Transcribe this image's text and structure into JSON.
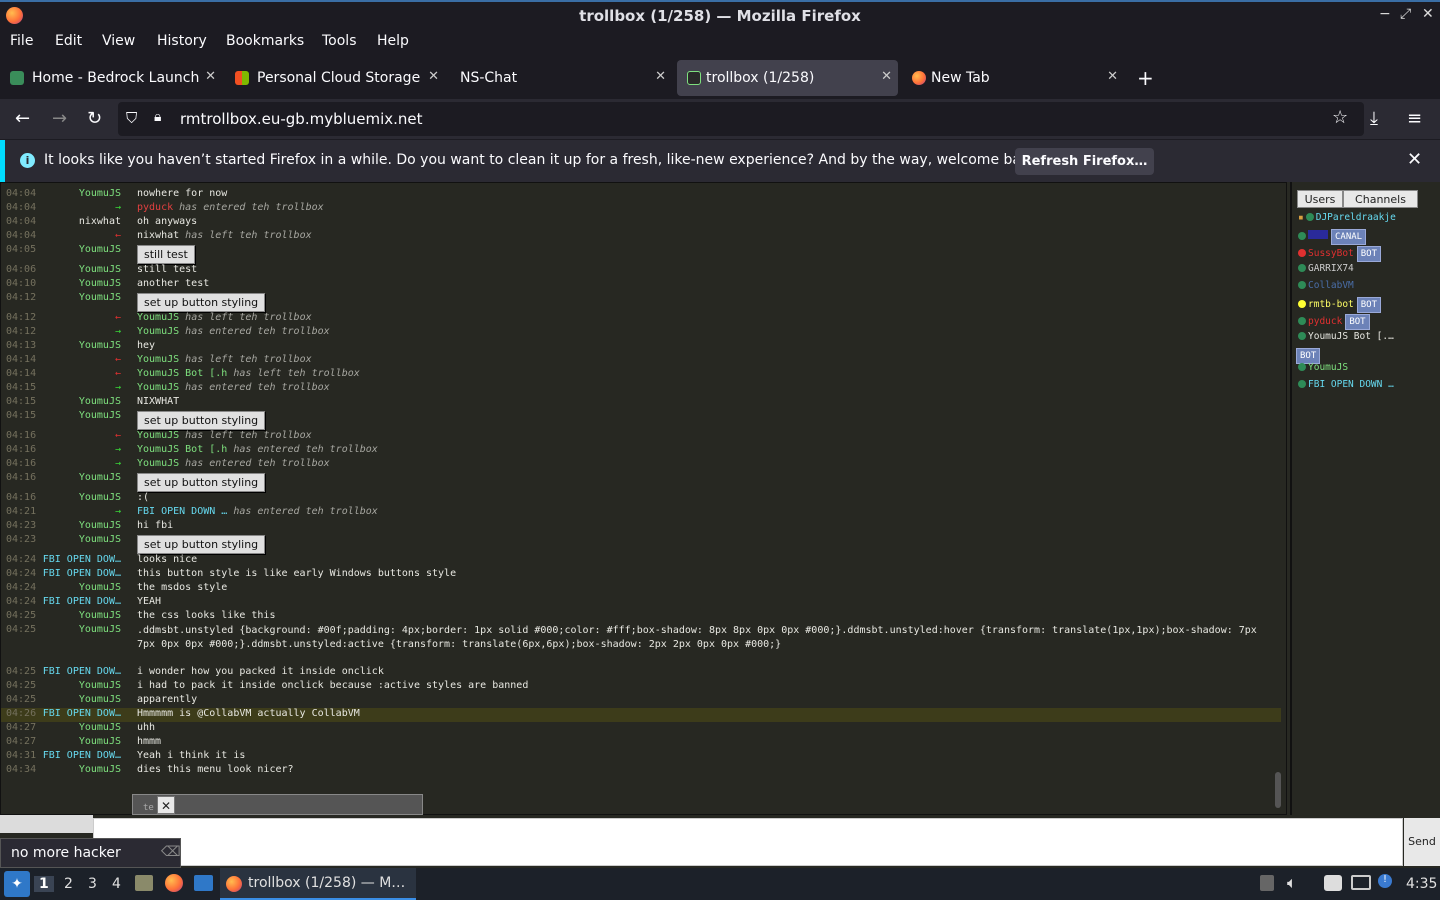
{
  "window": {
    "title": "trollbox (1/258) — Mozilla Firefox"
  },
  "menu": [
    "File",
    "Edit",
    "View",
    "History",
    "Bookmarks",
    "Tools",
    "Help"
  ],
  "tabs": [
    {
      "label": "Home - Bedrock Launcher"
    },
    {
      "label": "Personal Cloud Storage - "
    },
    {
      "label": "NS-Chat"
    },
    {
      "label": "trollbox (1/258)"
    },
    {
      "label": "New Tab"
    }
  ],
  "url": "rmtrollbox.eu-gb.mybluemix.net",
  "notification": {
    "message": "It looks like you haven’t started Firefox in a while. Do you want to clean it up for a fresh, like-new experience? And by the way, welcome back!",
    "button": "Refresh Firefox…"
  },
  "chat": [
    {
      "ts": "04:04",
      "nick": "YoumuJS",
      "text": "nowhere for now"
    },
    {
      "ts": "04:04",
      "nick": "",
      "arrow": "→",
      "who": "pyduck",
      "whocolor": "#e04040",
      "text": "has entered teh trollbox",
      "sys": true
    },
    {
      "ts": "04:04",
      "nick": "nixwhat",
      "nickcolor": "#e8e8e2",
      "text": "oh anyways"
    },
    {
      "ts": "04:04",
      "nick": "",
      "arrow": "←",
      "who": "nixwhat",
      "whocolor": "#e8e8e2",
      "text": "has left teh trollbox",
      "sys": true
    },
    {
      "ts": "04:05",
      "nick": "YoumuJS",
      "button": "still test"
    },
    {
      "ts": "04:06",
      "nick": "YoumuJS",
      "text": " still test"
    },
    {
      "ts": "04:10",
      "nick": "YoumuJS",
      "text": " another test"
    },
    {
      "ts": "04:12",
      "nick": "YoumuJS",
      "button": "set up button styling"
    },
    {
      "ts": "04:12",
      "nick": "",
      "arrow": "←",
      "who": "YoumuJS",
      "whocolor": "#7ee07e",
      "text": "has left teh trollbox",
      "sys": true
    },
    {
      "ts": "04:12",
      "nick": "",
      "arrow": "→",
      "who": "YoumuJS",
      "whocolor": "#7ee07e",
      "text": "has entered teh trollbox",
      "sys": true
    },
    {
      "ts": "04:13",
      "nick": "YoumuJS",
      "text": "hey"
    },
    {
      "ts": "04:14",
      "nick": "",
      "arrow": "←",
      "who": "YoumuJS",
      "whocolor": "#7ee07e",
      "text": "has left teh trollbox",
      "sys": true
    },
    {
      "ts": "04:14",
      "nick": "",
      "arrow": "←",
      "who": "YoumuJS Bot [.h",
      "whocolor": "#7ee07e",
      "text": "has left teh trollbox",
      "sys": true
    },
    {
      "ts": "04:15",
      "nick": "",
      "arrow": "→",
      "who": "YoumuJS",
      "whocolor": "#7ee07e",
      "text": "has entered teh trollbox",
      "sys": true
    },
    {
      "ts": "04:15",
      "nick": "YoumuJS",
      "text": "NIXWHAT"
    },
    {
      "ts": "04:15",
      "nick": "YoumuJS",
      "button": "set up button styling"
    },
    {
      "ts": "04:16",
      "nick": "",
      "arrow": "←",
      "who": "YoumuJS",
      "whocolor": "#7ee07e",
      "text": "has left teh trollbox",
      "sys": true
    },
    {
      "ts": "04:16",
      "nick": "",
      "arrow": "→",
      "who": "YoumuJS Bot [.h",
      "whocolor": "#7ee07e",
      "text": "has entered teh trollbox",
      "sys": true
    },
    {
      "ts": "04:16",
      "nick": "",
      "arrow": "→",
      "who": "YoumuJS",
      "whocolor": "#7ee07e",
      "text": "has entered teh trollbox",
      "sys": true
    },
    {
      "ts": "04:16",
      "nick": "YoumuJS",
      "button": "set up button styling"
    },
    {
      "ts": "04:16",
      "nick": "YoumuJS",
      "text": ":("
    },
    {
      "ts": "04:21",
      "nick": "",
      "arrow": "→",
      "who": "FBI OPEN DOWN …",
      "whocolor": "#66d9ef",
      "text": "has entered teh trollbox",
      "sys": true
    },
    {
      "ts": "04:23",
      "nick": "YoumuJS",
      "text": "hi fbi"
    },
    {
      "ts": "04:23",
      "nick": "YoumuJS",
      "button": "set up button styling"
    },
    {
      "ts": "04:24",
      "nick": "FBI OPEN DOW…",
      "nickcolor": "#66d9ef",
      "text": "looks nice"
    },
    {
      "ts": "04:24",
      "nick": "FBI OPEN DOW…",
      "nickcolor": "#66d9ef",
      "text": "this button style is like early Windows buttons style"
    },
    {
      "ts": "04:24",
      "nick": "YoumuJS",
      "text": "the msdos style"
    },
    {
      "ts": "04:24",
      "nick": "FBI OPEN DOW…",
      "nickcolor": "#66d9ef",
      "text": "YEAH"
    },
    {
      "ts": "04:25",
      "nick": "YoumuJS",
      "text": "the css looks like this"
    },
    {
      "ts": "04:25",
      "nick": "YoumuJS",
      "text": ".ddmsbt.unstyled {background: #00f;padding: 4px;border: 1px solid #000;color: #fff;box-shadow: 8px 8px 0px 0px #000;}.ddmsbt.unstyled:hover {transform: translate(1px,1px);box-shadow: 7px",
      "text2": "7px 0px 0px #000;}.ddmsbt.unstyled:active {transform: translate(6px,6px);box-shadow: 2px 2px 0px 0px #000;}"
    },
    {
      "ts": "04:25",
      "nick": "FBI OPEN DOW…",
      "nickcolor": "#66d9ef",
      "text": "i wonder how you packed it inside onclick"
    },
    {
      "ts": "04:25",
      "nick": "YoumuJS",
      "text": "i had to pack it inside onclick because :active styles are banned"
    },
    {
      "ts": "04:25",
      "nick": "YoumuJS",
      "text": "apparently"
    },
    {
      "ts": "04:26",
      "nick": "FBI OPEN DOW…",
      "nickcolor": "#66d9ef",
      "text": "Hmmmmm is @CollabVM actually CollabVM",
      "highlight": true
    },
    {
      "ts": "04:27",
      "nick": "YoumuJS",
      "text": "uhh"
    },
    {
      "ts": "04:27",
      "nick": "YoumuJS",
      "text": "hmmm"
    },
    {
      "ts": "04:31",
      "nick": "FBI OPEN DOW…",
      "nickcolor": "#66d9ef",
      "text": "Yeah i think it is"
    },
    {
      "ts": "04:34",
      "nick": "YoumuJS",
      "text": "dies this menu look nicer?"
    }
  ],
  "sidebar": {
    "tabs": [
      "Users",
      "Channels"
    ],
    "users": [
      {
        "name": "DJPareldraakje",
        "color": "#66d9ef",
        "dot": "#2e8b57",
        "extra": "lock"
      },
      {
        "name": "",
        "color": "#3a3ad0",
        "dot": "#2e8b57",
        "badge": "CANAL"
      },
      {
        "name": "SussyBot",
        "color": "#e03030",
        "dot": "#e03030",
        "badge": "BOT"
      },
      {
        "name": "GARRIX74",
        "color": "#cccccc",
        "dot": "#2e8b57"
      },
      {
        "name": "CollabVM",
        "color": "#4a6ea8",
        "dot": "#2e8b57"
      },
      {
        "name": "rmtb-bot",
        "color": "#ffff66",
        "dot": "#ffff33",
        "badge": "BOT"
      },
      {
        "name": "pyduck",
        "color": "#e03030",
        "dot": "#2e8b57",
        "badge": "BOT"
      },
      {
        "name": "YoumuJS Bot [.…",
        "color": "#e8e8e2",
        "dot": "#2e8b57",
        "badge2": "BOT"
      },
      {
        "name": "YoumuJS",
        "color": "#7ee07e",
        "dot": "#2e8b57"
      },
      {
        "name": "FBI OPEN DOWN …",
        "color": "#66d9ef",
        "dot": "#2e8b57"
      }
    ]
  },
  "input": {
    "send": "Send"
  },
  "popup_snippet": "te",
  "searchbox": {
    "value": "no more hacker"
  },
  "taskbar": {
    "workspaces": [
      "1",
      "2",
      "3",
      "4"
    ],
    "task": "trollbox (1/258) — M…",
    "clock": "4:35"
  }
}
